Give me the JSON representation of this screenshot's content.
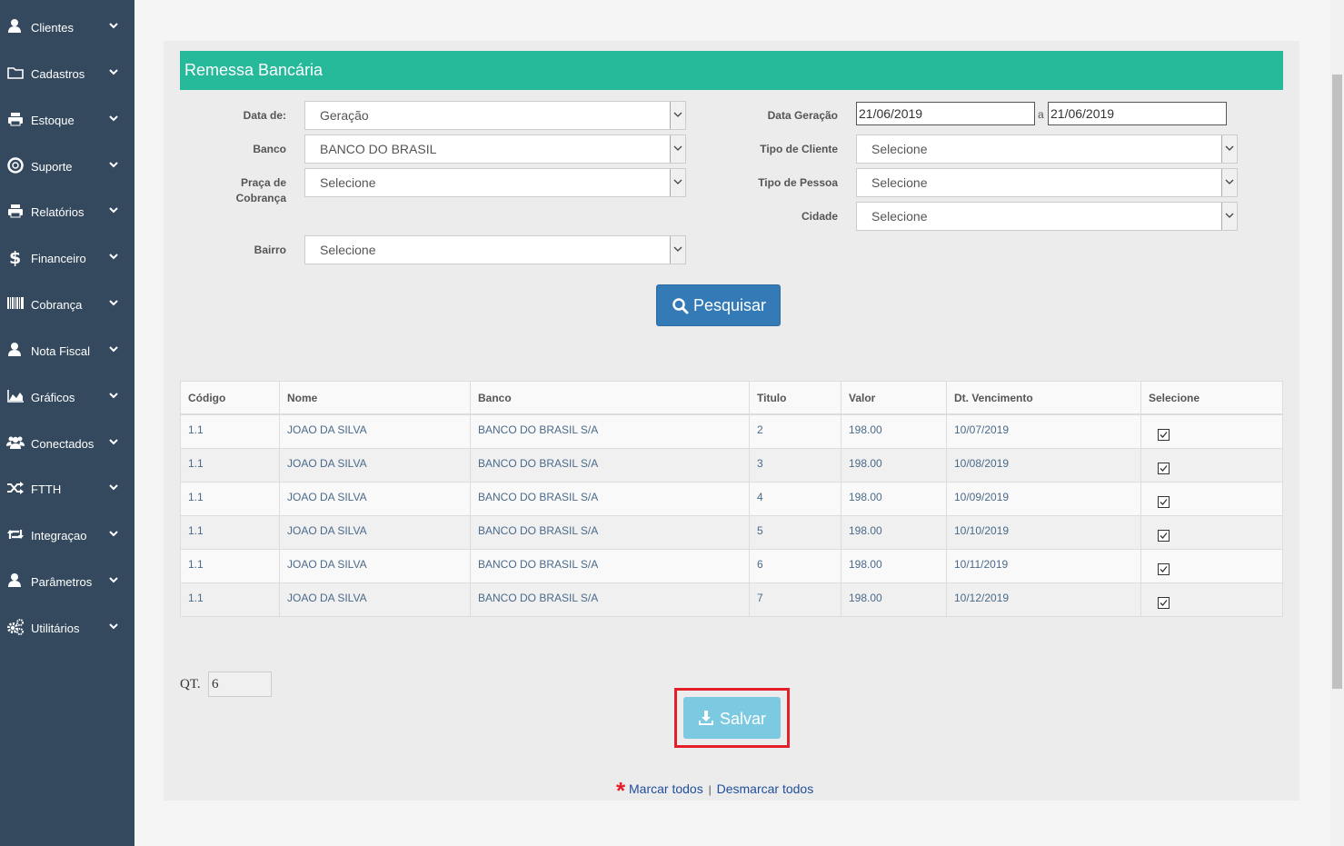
{
  "sidebar": {
    "items": [
      {
        "label": "Clientes",
        "icon": "user-icon"
      },
      {
        "label": "Cadastros",
        "icon": "folder-icon"
      },
      {
        "label": "Estoque",
        "icon": "printer-icon"
      },
      {
        "label": "Suporte",
        "icon": "lifebuoy-icon"
      },
      {
        "label": "Relatórios",
        "icon": "printer-icon"
      },
      {
        "label": "Financeiro",
        "icon": "dollar-icon"
      },
      {
        "label": "Cobrança",
        "icon": "barcode-icon"
      },
      {
        "label": "Nota Fiscal",
        "icon": "user-icon"
      },
      {
        "label": "Gráficos",
        "icon": "area-chart-icon"
      },
      {
        "label": "Conectados",
        "icon": "users-icon"
      },
      {
        "label": "FTTH",
        "icon": "random-icon"
      },
      {
        "label": "Integraçao",
        "icon": "retweet-icon"
      },
      {
        "label": "Parâmetros",
        "icon": "user-icon"
      },
      {
        "label": "Utilitários",
        "icon": "cogs-icon"
      }
    ]
  },
  "panel": {
    "title": "Remessa Bancária"
  },
  "filters": {
    "data_de": {
      "label": "Data de:",
      "value": "Geração"
    },
    "banco": {
      "label": "Banco",
      "value": "BANCO DO BRASIL"
    },
    "praca": {
      "label_line1": "Praça de",
      "label_line2": "Cobrança",
      "value": "Selecione"
    },
    "bairro": {
      "label": "Bairro",
      "value": "Selecione"
    },
    "data_geracao": {
      "label": "Data Geração",
      "from": "21/06/2019",
      "separator": "a",
      "to": "21/06/2019"
    },
    "tipo_cliente": {
      "label": "Tipo de Cliente",
      "value": "Selecione"
    },
    "tipo_pessoa": {
      "label": "Tipo de Pessoa",
      "value": "Selecione"
    },
    "cidade": {
      "label": "Cidade",
      "value": "Selecione"
    }
  },
  "search_button": {
    "label": "Pesquisar"
  },
  "table": {
    "columns": [
      "Código",
      "Nome",
      "Banco",
      "Titulo",
      "Valor",
      "Dt. Vencimento",
      "Selecione"
    ],
    "rows": [
      {
        "codigo": "1.1",
        "nome": "JOAO DA SILVA",
        "banco": "BANCO DO BRASIL S/A",
        "titulo": "2",
        "valor": "198.00",
        "vencimento": "10/07/2019",
        "checked": true
      },
      {
        "codigo": "1.1",
        "nome": "JOAO DA SILVA",
        "banco": "BANCO DO BRASIL S/A",
        "titulo": "3",
        "valor": "198.00",
        "vencimento": "10/08/2019",
        "checked": true
      },
      {
        "codigo": "1.1",
        "nome": "JOAO DA SILVA",
        "banco": "BANCO DO BRASIL S/A",
        "titulo": "4",
        "valor": "198.00",
        "vencimento": "10/09/2019",
        "checked": true
      },
      {
        "codigo": "1.1",
        "nome": "JOAO DA SILVA",
        "banco": "BANCO DO BRASIL S/A",
        "titulo": "5",
        "valor": "198.00",
        "vencimento": "10/10/2019",
        "checked": true
      },
      {
        "codigo": "1.1",
        "nome": "JOAO DA SILVA",
        "banco": "BANCO DO BRASIL S/A",
        "titulo": "6",
        "valor": "198.00",
        "vencimento": "10/11/2019",
        "checked": true
      },
      {
        "codigo": "1.1",
        "nome": "JOAO DA SILVA",
        "banco": "BANCO DO BRASIL S/A",
        "titulo": "7",
        "valor": "198.00",
        "vencimento": "10/12/2019",
        "checked": true
      }
    ]
  },
  "qt": {
    "label": "QT.",
    "value": "6"
  },
  "save_button": {
    "label": "Salvar"
  },
  "links": {
    "star": "*",
    "mark_all": "Marcar todos",
    "separator": "|",
    "unmark_all": "Desmarcar todos"
  },
  "colors": {
    "sidebar": "#34495e",
    "header": "#26b99a",
    "primary": "#337ab7",
    "save": "#7cc9e2",
    "highlight": "#e3202a"
  }
}
